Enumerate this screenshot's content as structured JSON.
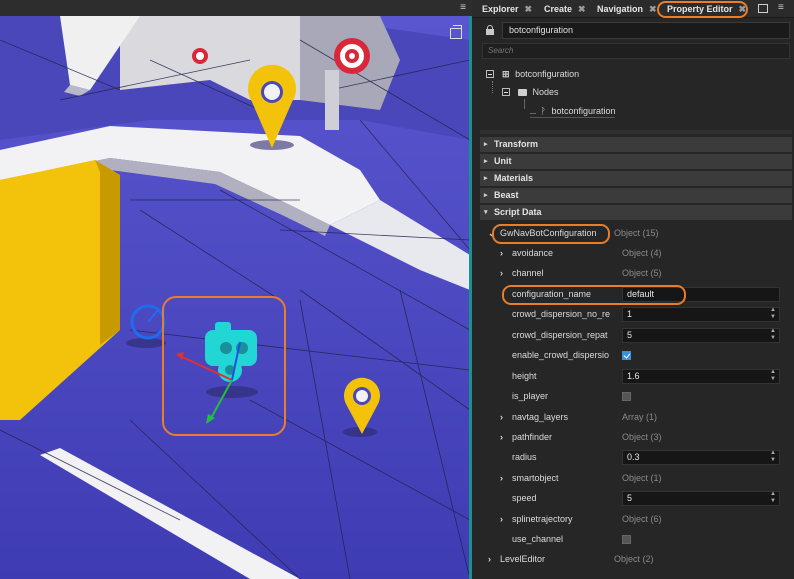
{
  "viewport": {
    "menu_glyph": "≡"
  },
  "tabs": [
    {
      "label": "Explorer",
      "close": "✖"
    },
    {
      "label": "Create",
      "close": "✖"
    },
    {
      "label": "Navigation",
      "close": "✖"
    },
    {
      "label": "Property Editor",
      "close": "✖"
    }
  ],
  "tab_menu_glyph": "≡",
  "object_name": "botconfiguration",
  "search_placeholder": "Search",
  "tree": {
    "root": "botconfiguration",
    "nodes_folder": "Nodes",
    "child": "botconfiguration"
  },
  "sections": [
    "Transform",
    "Unit",
    "Materials",
    "Beast",
    "Script Data"
  ],
  "properties": {
    "root_label": "GwNavBotConfiguration",
    "root_value": "Object (15)",
    "rows": [
      {
        "label": "avoidance",
        "value": "Object (4)"
      },
      {
        "label": "channel",
        "value": "Object (5)"
      },
      {
        "label": "configuration_name",
        "value": "default"
      },
      {
        "label": "crowd_dispersion_no_re",
        "value": "1"
      },
      {
        "label": "crowd_dispersion_repat",
        "value": "5"
      },
      {
        "label": "enable_crowd_dispersio",
        "value": ""
      },
      {
        "label": "height",
        "value": "1.6"
      },
      {
        "label": "is_player",
        "value": ""
      },
      {
        "label": "navtag_layers",
        "value": "Array (1)"
      },
      {
        "label": "pathfinder",
        "value": "Object (3)"
      },
      {
        "label": "radius",
        "value": "0.3"
      },
      {
        "label": "smartobject",
        "value": "Object (1)"
      },
      {
        "label": "speed",
        "value": "5"
      },
      {
        "label": "splinetrajectory",
        "value": "Object (6)"
      },
      {
        "label": "use_channel",
        "value": ""
      }
    ],
    "footer_label": "LevelEditor",
    "footer_value": "Object (2)"
  },
  "checkbox_states": {
    "enable_crowd_dispersio": true,
    "is_player": false,
    "use_channel": false
  },
  "colors": {
    "accent_orange": "#e87d2a",
    "navmesh_blue": "#4f4cc4",
    "marker_yellow": "#f2c30a",
    "target_red": "#d8283a",
    "gizmo_cyan": "#22d6d6",
    "checkbox_blue": "#3a8fd9"
  },
  "icons": [
    "lock-icon",
    "search-icon",
    "gear-icon",
    "key-icon",
    "maximize-icon",
    "undock-icon",
    "folder-icon",
    "node-icon",
    "hierarchy-icon"
  ]
}
